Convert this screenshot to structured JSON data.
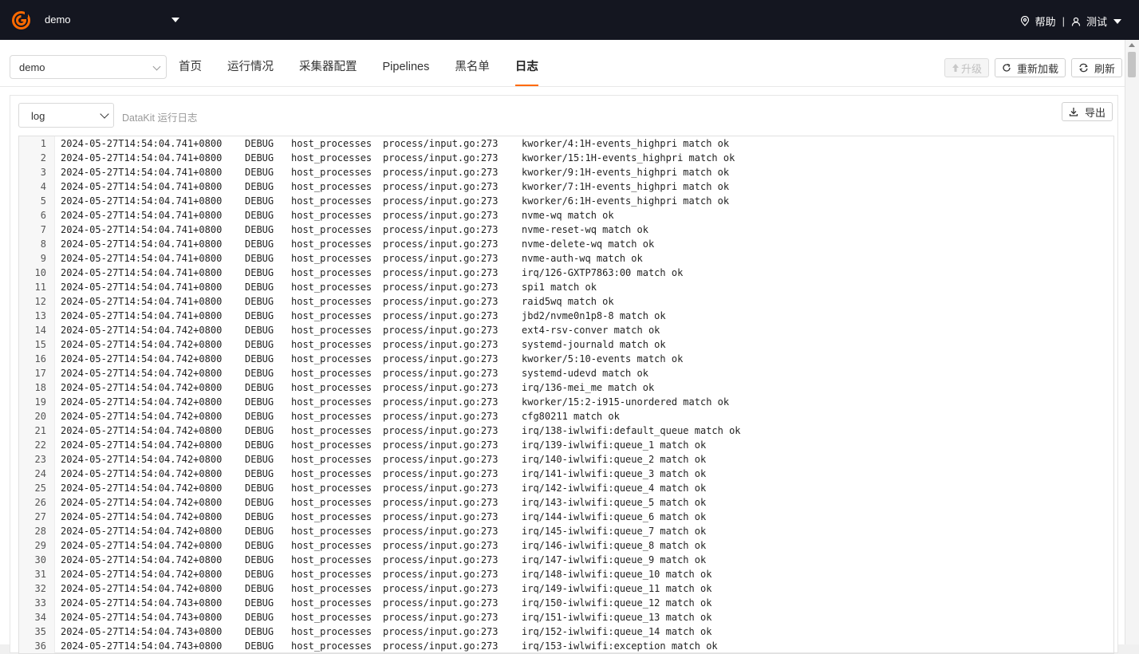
{
  "topbar": {
    "app_name": "demo",
    "help_label": "帮助",
    "separator": "|",
    "user_name": "测试",
    "brand_color": "#ff6a00"
  },
  "header": {
    "project_select_value": "demo",
    "tabs": [
      {
        "label": "首页",
        "active": false
      },
      {
        "label": "运行情况",
        "active": false
      },
      {
        "label": "采集器配置",
        "active": false
      },
      {
        "label": "Pipelines",
        "active": false
      },
      {
        "label": "黑名单",
        "active": false
      },
      {
        "label": "日志",
        "active": true
      }
    ],
    "upgrade_label": "升级",
    "reload_label": "重新加载",
    "refresh_label": "刷新"
  },
  "log_panel": {
    "type_select_value": "log",
    "description": "DataKit 运行日志",
    "export_label": "导出",
    "rows": [
      [
        "1",
        "2024-05-27T14:54:04.741+0800",
        "DEBUG",
        "host_processes",
        "process/input.go:273",
        "kworker/4:1H-events_highpri match ok"
      ],
      [
        "2",
        "2024-05-27T14:54:04.741+0800",
        "DEBUG",
        "host_processes",
        "process/input.go:273",
        "kworker/15:1H-events_highpri match ok"
      ],
      [
        "3",
        "2024-05-27T14:54:04.741+0800",
        "DEBUG",
        "host_processes",
        "process/input.go:273",
        "kworker/9:1H-events_highpri match ok"
      ],
      [
        "4",
        "2024-05-27T14:54:04.741+0800",
        "DEBUG",
        "host_processes",
        "process/input.go:273",
        "kworker/7:1H-events_highpri match ok"
      ],
      [
        "5",
        "2024-05-27T14:54:04.741+0800",
        "DEBUG",
        "host_processes",
        "process/input.go:273",
        "kworker/6:1H-events_highpri match ok"
      ],
      [
        "6",
        "2024-05-27T14:54:04.741+0800",
        "DEBUG",
        "host_processes",
        "process/input.go:273",
        "nvme-wq match ok"
      ],
      [
        "7",
        "2024-05-27T14:54:04.741+0800",
        "DEBUG",
        "host_processes",
        "process/input.go:273",
        "nvme-reset-wq match ok"
      ],
      [
        "8",
        "2024-05-27T14:54:04.741+0800",
        "DEBUG",
        "host_processes",
        "process/input.go:273",
        "nvme-delete-wq match ok"
      ],
      [
        "9",
        "2024-05-27T14:54:04.741+0800",
        "DEBUG",
        "host_processes",
        "process/input.go:273",
        "nvme-auth-wq match ok"
      ],
      [
        "10",
        "2024-05-27T14:54:04.741+0800",
        "DEBUG",
        "host_processes",
        "process/input.go:273",
        "irq/126-GXTP7863:00 match ok"
      ],
      [
        "11",
        "2024-05-27T14:54:04.741+0800",
        "DEBUG",
        "host_processes",
        "process/input.go:273",
        "spi1 match ok"
      ],
      [
        "12",
        "2024-05-27T14:54:04.741+0800",
        "DEBUG",
        "host_processes",
        "process/input.go:273",
        "raid5wq match ok"
      ],
      [
        "13",
        "2024-05-27T14:54:04.741+0800",
        "DEBUG",
        "host_processes",
        "process/input.go:273",
        "jbd2/nvme0n1p8-8 match ok"
      ],
      [
        "14",
        "2024-05-27T14:54:04.742+0800",
        "DEBUG",
        "host_processes",
        "process/input.go:273",
        "ext4-rsv-conver match ok"
      ],
      [
        "15",
        "2024-05-27T14:54:04.742+0800",
        "DEBUG",
        "host_processes",
        "process/input.go:273",
        "systemd-journald match ok"
      ],
      [
        "16",
        "2024-05-27T14:54:04.742+0800",
        "DEBUG",
        "host_processes",
        "process/input.go:273",
        "kworker/5:10-events match ok"
      ],
      [
        "17",
        "2024-05-27T14:54:04.742+0800",
        "DEBUG",
        "host_processes",
        "process/input.go:273",
        "systemd-udevd match ok"
      ],
      [
        "18",
        "2024-05-27T14:54:04.742+0800",
        "DEBUG",
        "host_processes",
        "process/input.go:273",
        "irq/136-mei_me match ok"
      ],
      [
        "19",
        "2024-05-27T14:54:04.742+0800",
        "DEBUG",
        "host_processes",
        "process/input.go:273",
        "kworker/15:2-i915-unordered match ok"
      ],
      [
        "20",
        "2024-05-27T14:54:04.742+0800",
        "DEBUG",
        "host_processes",
        "process/input.go:273",
        "cfg80211 match ok"
      ],
      [
        "21",
        "2024-05-27T14:54:04.742+0800",
        "DEBUG",
        "host_processes",
        "process/input.go:273",
        "irq/138-iwlwifi:default_queue match ok"
      ],
      [
        "22",
        "2024-05-27T14:54:04.742+0800",
        "DEBUG",
        "host_processes",
        "process/input.go:273",
        "irq/139-iwlwifi:queue_1 match ok"
      ],
      [
        "23",
        "2024-05-27T14:54:04.742+0800",
        "DEBUG",
        "host_processes",
        "process/input.go:273",
        "irq/140-iwlwifi:queue_2 match ok"
      ],
      [
        "24",
        "2024-05-27T14:54:04.742+0800",
        "DEBUG",
        "host_processes",
        "process/input.go:273",
        "irq/141-iwlwifi:queue_3 match ok"
      ],
      [
        "25",
        "2024-05-27T14:54:04.742+0800",
        "DEBUG",
        "host_processes",
        "process/input.go:273",
        "irq/142-iwlwifi:queue_4 match ok"
      ],
      [
        "26",
        "2024-05-27T14:54:04.742+0800",
        "DEBUG",
        "host_processes",
        "process/input.go:273",
        "irq/143-iwlwifi:queue_5 match ok"
      ],
      [
        "27",
        "2024-05-27T14:54:04.742+0800",
        "DEBUG",
        "host_processes",
        "process/input.go:273",
        "irq/144-iwlwifi:queue_6 match ok"
      ],
      [
        "28",
        "2024-05-27T14:54:04.742+0800",
        "DEBUG",
        "host_processes",
        "process/input.go:273",
        "irq/145-iwlwifi:queue_7 match ok"
      ],
      [
        "29",
        "2024-05-27T14:54:04.742+0800",
        "DEBUG",
        "host_processes",
        "process/input.go:273",
        "irq/146-iwlwifi:queue_8 match ok"
      ],
      [
        "30",
        "2024-05-27T14:54:04.742+0800",
        "DEBUG",
        "host_processes",
        "process/input.go:273",
        "irq/147-iwlwifi:queue_9 match ok"
      ],
      [
        "31",
        "2024-05-27T14:54:04.742+0800",
        "DEBUG",
        "host_processes",
        "process/input.go:273",
        "irq/148-iwlwifi:queue_10 match ok"
      ],
      [
        "32",
        "2024-05-27T14:54:04.742+0800",
        "DEBUG",
        "host_processes",
        "process/input.go:273",
        "irq/149-iwlwifi:queue_11 match ok"
      ],
      [
        "33",
        "2024-05-27T14:54:04.743+0800",
        "DEBUG",
        "host_processes",
        "process/input.go:273",
        "irq/150-iwlwifi:queue_12 match ok"
      ],
      [
        "34",
        "2024-05-27T14:54:04.743+0800",
        "DEBUG",
        "host_processes",
        "process/input.go:273",
        "irq/151-iwlwifi:queue_13 match ok"
      ],
      [
        "35",
        "2024-05-27T14:54:04.743+0800",
        "DEBUG",
        "host_processes",
        "process/input.go:273",
        "irq/152-iwlwifi:queue_14 match ok"
      ],
      [
        "36",
        "2024-05-27T14:54:04.743+0800",
        "DEBUG",
        "host_processes",
        "process/input.go:273",
        "irq/153-iwlwifi:exception match ok"
      ]
    ]
  }
}
